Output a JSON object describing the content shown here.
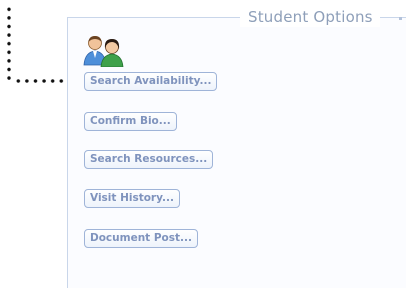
{
  "panel": {
    "title": "Student Options"
  },
  "avatar": {
    "icon": "people-icon"
  },
  "options": [
    {
      "label": "Search Availability..."
    },
    {
      "label": "Confirm Bio..."
    },
    {
      "label": "Search Resources..."
    },
    {
      "label": "Visit History..."
    },
    {
      "label": "Document Post..."
    }
  ]
}
